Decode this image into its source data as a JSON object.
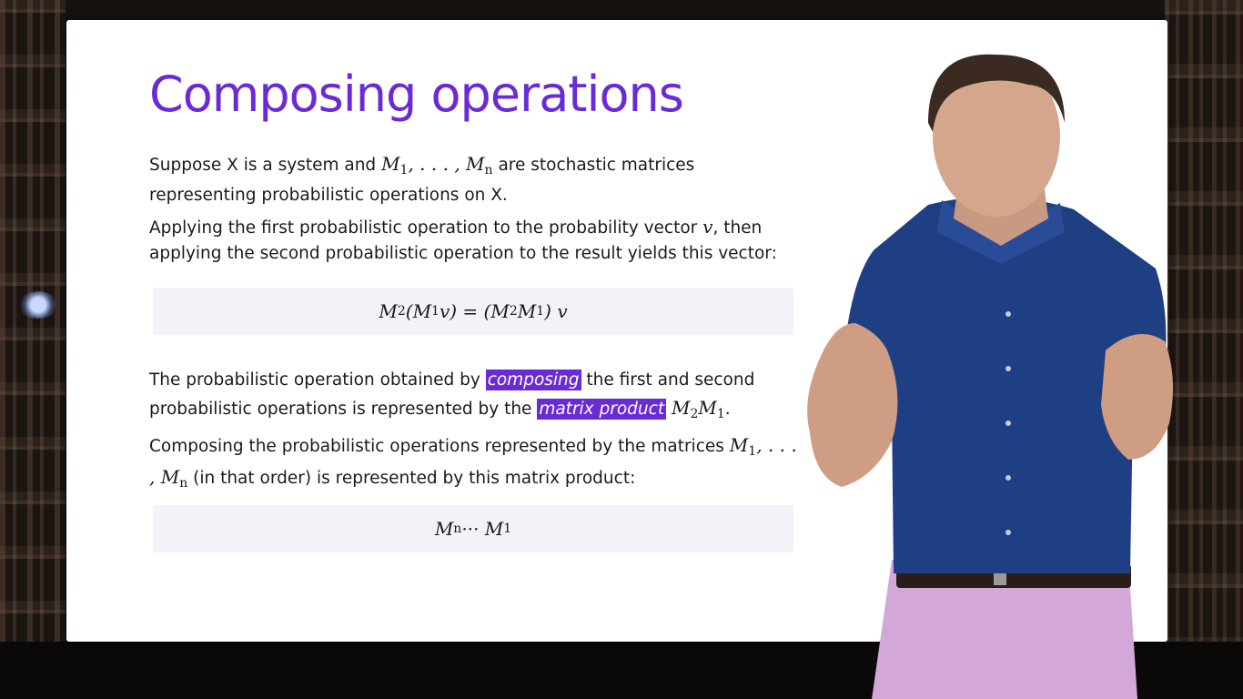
{
  "slide": {
    "title": "Composing operations",
    "p1": {
      "t1": "Suppose X is a system and ",
      "m1": "M",
      "s1": "1",
      "t2": ", . . . , ",
      "m2": "M",
      "s2": "n",
      "t3": " are stochastic matrices representing probabilistic operations on X."
    },
    "p2": {
      "t1": "Applying the first probabilistic operation to the probability vector ",
      "v": "v",
      "t2": ", then applying the second probabilistic operation to the result yields this vector:"
    },
    "eq1": {
      "a": "M",
      "as": "2",
      "b": "(M",
      "bs": "1",
      "c": "v) = (M",
      "cs": "2",
      "d": "M",
      "ds": "1",
      "e": ") v"
    },
    "p3": {
      "t1": "The probabilistic operation obtained by ",
      "h1": "composing",
      "t2": " the first and second probabilistic operations is represented by the ",
      "h2": "matrix product",
      "t3": " ",
      "m1": "M",
      "s1": "2",
      "m2": "M",
      "s2": "1",
      "t4": "."
    },
    "p4": {
      "t1": "Composing the probabilistic operations represented by the matrices ",
      "m1": "M",
      "s1": "1",
      "t2": ", . . . , ",
      "m2": "M",
      "s2": "n",
      "t3": " (in that order) is represented by this matrix product:"
    },
    "eq2": {
      "a": "M",
      "as": "n",
      "b": " ··· M",
      "bs": "1"
    }
  },
  "colors": {
    "accent": "#6a2ad6",
    "shirt": "#1f3f85",
    "pants": "#d3a7d8"
  }
}
